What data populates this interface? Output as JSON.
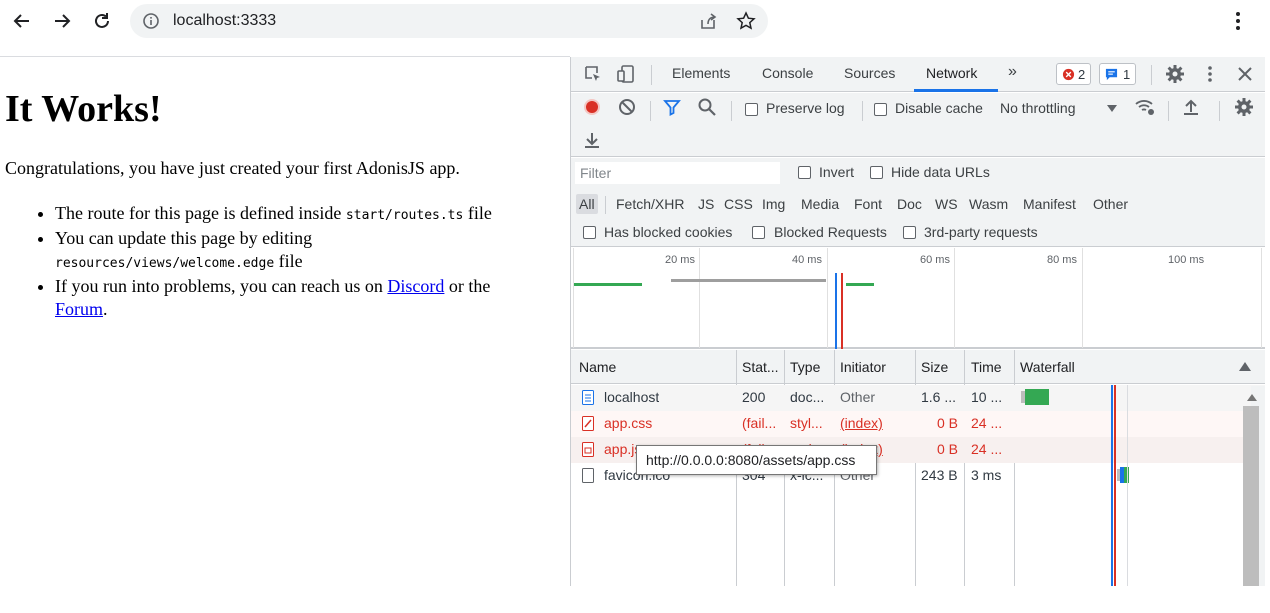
{
  "browser": {
    "url": "localhost:3333"
  },
  "page": {
    "title": "It Works!",
    "intro": "Congratulations, you have just created your first AdonisJS app.",
    "item1_pre": "The route for this page is defined inside ",
    "item1_code": "start/routes.ts",
    "item1_post": " file",
    "item2_pre": "You can update this page by editing ",
    "item2_code": "resources/views/welcome.edge",
    "item2_post": " file",
    "item3_pre": "If you run into problems, you can reach us on ",
    "item3_link1": "Discord",
    "item3_mid": " or the ",
    "item3_link2": "Forum",
    "item3_post": "."
  },
  "devtools": {
    "tabs": [
      "Elements",
      "Console",
      "Sources",
      "Network"
    ],
    "more": "»",
    "errors_count": "2",
    "messages_count": "1",
    "preserve_log": "Preserve log",
    "disable_cache": "Disable cache",
    "throttling": "No throttling",
    "filter_placeholder": "Filter",
    "invert": "Invert",
    "hide_data_urls": "Hide data URLs",
    "types": [
      "All",
      "Fetch/XHR",
      "JS",
      "CSS",
      "Img",
      "Media",
      "Font",
      "Doc",
      "WS",
      "Wasm",
      "Manifest",
      "Other"
    ],
    "has_blocked_cookies": "Has blocked cookies",
    "blocked_requests": "Blocked Requests",
    "third_party": "3rd-party requests",
    "ticks": [
      "20 ms",
      "40 ms",
      "60 ms",
      "80 ms",
      "100 ms"
    ],
    "columns": [
      "Name",
      "Stat...",
      "Type",
      "Initiator",
      "Size",
      "Time",
      "Waterfall"
    ],
    "rows": [
      {
        "name": "localhost",
        "status": "200",
        "type": "doc...",
        "initiator": "Other",
        "size": "1.6 ...",
        "time": "10 ..."
      },
      {
        "name": "app.css",
        "status": "(fail...",
        "type": "styl...",
        "initiator": "(index)",
        "size": "0 B",
        "time": "24 ..."
      },
      {
        "name": "app.js",
        "status": "(fail...",
        "type": "scri...",
        "initiator": "(index)",
        "size": "0 B",
        "time": "24 ..."
      },
      {
        "name": "favicon.ico",
        "status": "304",
        "type": "x-ic...",
        "initiator": "Other",
        "size": "243 B",
        "time": "3 ms"
      }
    ],
    "tooltip": "http://0.0.0.0:8080/assets/app.css"
  },
  "colors": {
    "accent": "#1a73e8",
    "error": "#d93025",
    "record": "#d93025",
    "waterfall_green": "#34a853",
    "waterfall_blue": "#1a73e8"
  }
}
